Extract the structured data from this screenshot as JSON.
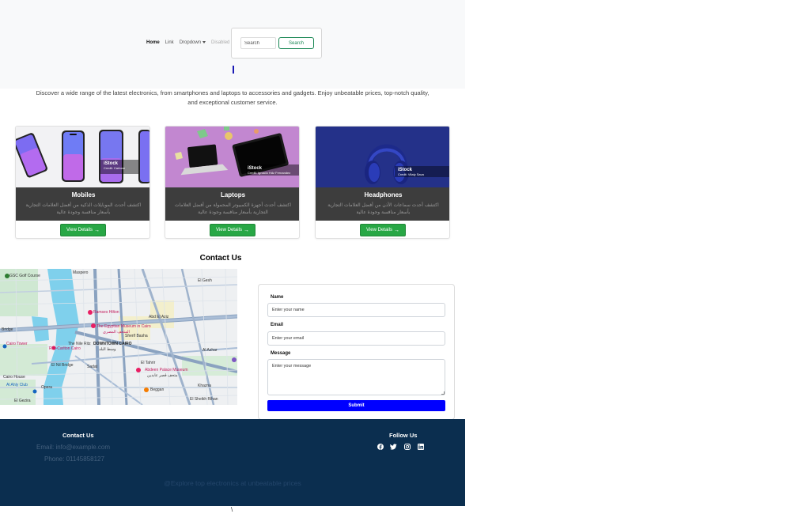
{
  "nav": {
    "items": [
      {
        "label": "Home",
        "state": "active"
      },
      {
        "label": "Link",
        "state": "normal"
      },
      {
        "label": "Dropdown",
        "state": "dropdown"
      },
      {
        "label": "Disabled",
        "state": "disabled"
      }
    ],
    "search_placeholder": "Search",
    "search_button": "Search"
  },
  "intro": {
    "text": "Discover a wide range of the latest electronics, from smartphones and laptops to accessories and gadgets. Enjoy unbeatable prices, top-notch quality, and exceptional customer service."
  },
  "products": [
    {
      "title": "Mobiles",
      "desc": "اكتشف أحدث الموبايلات الذكية من أفضل العلامات التجارية بأسعار منافسة وجودة عالية",
      "button": "View Details",
      "watermark": "iStock",
      "credit": "Credit: Cartone"
    },
    {
      "title": "Laptops",
      "desc": "اكتشف أحدث أجهزة الكمبيوتر المحمولة من أفضل العلامات التجارية بأسعار منافسة وجودة عالية",
      "button": "View Details",
      "watermark": "iStock",
      "credit": "Credit: Ignacio Hdz Fernandez"
    },
    {
      "title": "Headphones",
      "desc": "اكتشف أحدث سماعات الأذن من أفضل العلامات التجارية بأسعار منافسة وجودة عالية",
      "button": "View Details",
      "watermark": "iStock",
      "credit": "Credit: Vitaly Sava"
    }
  ],
  "contact": {
    "title": "Contact Us",
    "name_label": "Name",
    "name_placeholder": "Enter your name",
    "email_label": "Email",
    "email_placeholder": "Enter your email",
    "message_label": "Message",
    "message_placeholder": "Enter your message",
    "submit": "Submit"
  },
  "map": {
    "labels": {
      "gsc": "GSC Golf Course",
      "maspero": "Maspero",
      "ramses": "Ramses Hilton",
      "egyptian_museum": "The Egyptian Museum in Cairo",
      "egyptian_museum_ar": "المتحف المصري",
      "downtown": "DOWNTOWN CAIRO",
      "downtown_ar": "وسط البلد",
      "cairo_tower": "Cairo Tower",
      "ritz": "Ritz-Carlton Cairo",
      "nile": "The Nile Ritz",
      "el_nil": "El Nil Bridge",
      "sadat": "Sadat",
      "abdeen": "Abdeen Palace Museum",
      "abdeen_ar": "متحف قصر عابدين",
      "beggan": "Beggan",
      "gezira": "El Gezira",
      "opera": "Opera",
      "bridge": "Bridge",
      "abd_el_aziz": "Abd El Aziz",
      "tahrir": "El Tahrir",
      "khazna": "Khazna",
      "al_azhar": "Al Azhar",
      "el_gesh": "El Gesh",
      "el_sheikh": "El Sheikh Rihan",
      "sherif": "Sherif Basha",
      "ahly": "Al Ahly Club",
      "cairo_house": "Cairo House"
    }
  },
  "footer": {
    "contact_heading": "Contact Us",
    "email": "Email: info@example.com",
    "phone": "Phone: 01145858127",
    "follow_heading": "Follow Us",
    "tagline": "@Explore top electronics at unbeatable prices",
    "social": [
      "facebook-icon",
      "twitter-icon",
      "instagram-icon",
      "linkedin-icon"
    ]
  },
  "colors": {
    "footer_bg": "#0b2e4f",
    "view_button": "#28a745",
    "submit_button": "#0000ff",
    "search_button": "#198754"
  }
}
